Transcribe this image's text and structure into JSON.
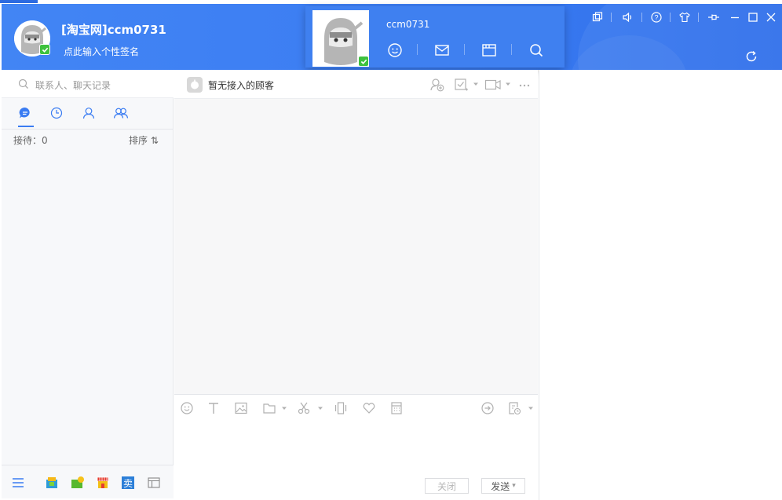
{
  "header": {
    "user_name": "[淘宝网]ccm0731",
    "signature_prompt": "点此输入个性签名"
  },
  "popup": {
    "user_name": "ccm0731"
  },
  "left_panel": {
    "search_placeholder": "联系人、聊天记录",
    "reception_label": "接待：0",
    "sort_label": "排序 ⇅"
  },
  "chat": {
    "title": "暂无接入的顾客",
    "close_button": "关闭",
    "send_button": "发送",
    "send_dropdown_arrow": "▾"
  },
  "icons": {
    "header": [
      "minimize-to-tray-icon",
      "speaker-icon",
      "help-icon",
      "shirt-skin-icon",
      "pin-icon",
      "minimize-icon",
      "maximize-icon",
      "close-icon",
      "refresh-icon"
    ],
    "popup": [
      "smiley-icon",
      "mail-icon",
      "browser-icon",
      "search-icon"
    ],
    "tabs": [
      "chat-bubble-icon",
      "clock-icon",
      "contact-icon",
      "group-icon"
    ],
    "chat_header": [
      "add-contact-icon",
      "task-icon",
      "video-icon",
      "more-icon"
    ],
    "toolbar": [
      "emoji-icon",
      "text-font-icon",
      "image-icon",
      "folder-icon",
      "scissors-icon",
      "shake-icon",
      "heart-icon",
      "calculator-icon",
      "quick-reply-icon",
      "history-icon"
    ],
    "bottom_bar": [
      "menu-icon",
      "app-store-icon",
      "app-wallet-icon",
      "app-shop-icon",
      "app-sell-icon",
      "panel-toggle-icon"
    ]
  },
  "colors": {
    "header_blue": "#4285f4",
    "accent": "#3a7cf2",
    "status_green": "#3ec13e"
  }
}
